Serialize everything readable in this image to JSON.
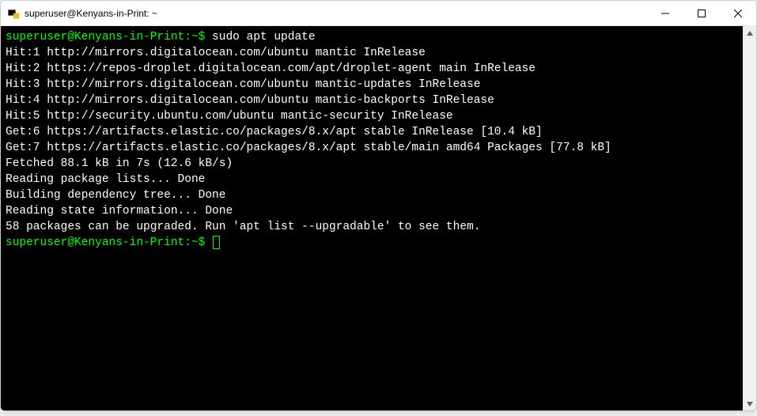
{
  "window": {
    "title": "superuser@Kenyans-in-Print: ~"
  },
  "terminal": {
    "prompt1": "superuser@Kenyans-in-Print:~$ ",
    "command1": "sudo apt update",
    "lines": [
      "Hit:1 http://mirrors.digitalocean.com/ubuntu mantic InRelease",
      "Hit:2 https://repos-droplet.digitalocean.com/apt/droplet-agent main InRelease",
      "Hit:3 http://mirrors.digitalocean.com/ubuntu mantic-updates InRelease",
      "Hit:4 http://mirrors.digitalocean.com/ubuntu mantic-backports InRelease",
      "Hit:5 http://security.ubuntu.com/ubuntu mantic-security InRelease",
      "Get:6 https://artifacts.elastic.co/packages/8.x/apt stable InRelease [10.4 kB]",
      "Get:7 https://artifacts.elastic.co/packages/8.x/apt stable/main amd64 Packages [77.8 kB]",
      "Fetched 88.1 kB in 7s (12.6 kB/s)",
      "Reading package lists... Done",
      "Building dependency tree... Done",
      "Reading state information... Done",
      "58 packages can be upgraded. Run 'apt list --upgradable' to see them."
    ],
    "prompt2": "superuser@Kenyans-in-Print:~$ "
  }
}
